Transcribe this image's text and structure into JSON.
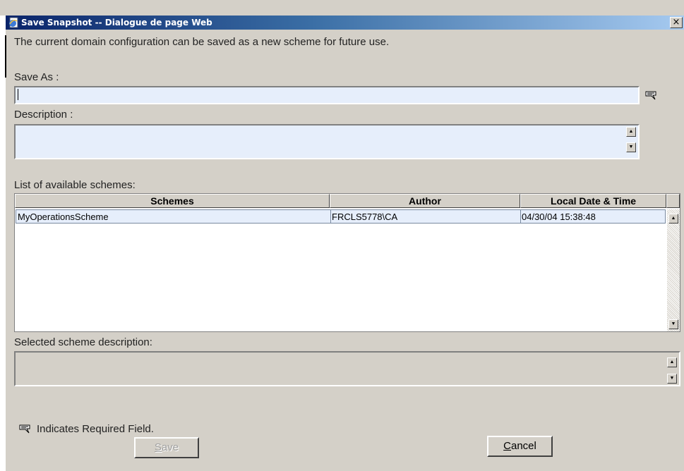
{
  "window": {
    "title": "Save Snapshot -- Dialogue de page Web",
    "close_symbol": "×"
  },
  "intro_text": "The current domain configuration can be saved as a new scheme for future use.",
  "save_as": {
    "label": "Save As :",
    "value": ""
  },
  "description": {
    "label": "Description :",
    "value": ""
  },
  "schemes": {
    "label": "List of available schemes:",
    "columns": [
      "Schemes",
      "Author",
      "Local Date & Time"
    ],
    "rows": [
      {
        "scheme": "MyOperationsScheme",
        "author": "FRCLS5778\\CA",
        "date": "04/30/04 15:38:48"
      }
    ]
  },
  "selected_description": {
    "label": "Selected scheme description:",
    "value": ""
  },
  "required_note": "Indicates Required Field.",
  "buttons": {
    "save": {
      "accel": "S",
      "rest": "ave",
      "disabled": true
    },
    "cancel": {
      "accel": "C",
      "rest": "ancel"
    }
  },
  "icons": {
    "window": "ie-page-icon",
    "required": "required-field-icon",
    "scroll_up": "scroll-up-arrow-icon",
    "scroll_down": "scroll-down-arrow-icon"
  },
  "colors": {
    "title_start": "#0a246a",
    "title_end": "#a6caf0",
    "dialog_bg": "#d4d0c8",
    "field_bg": "#e6eefb"
  }
}
